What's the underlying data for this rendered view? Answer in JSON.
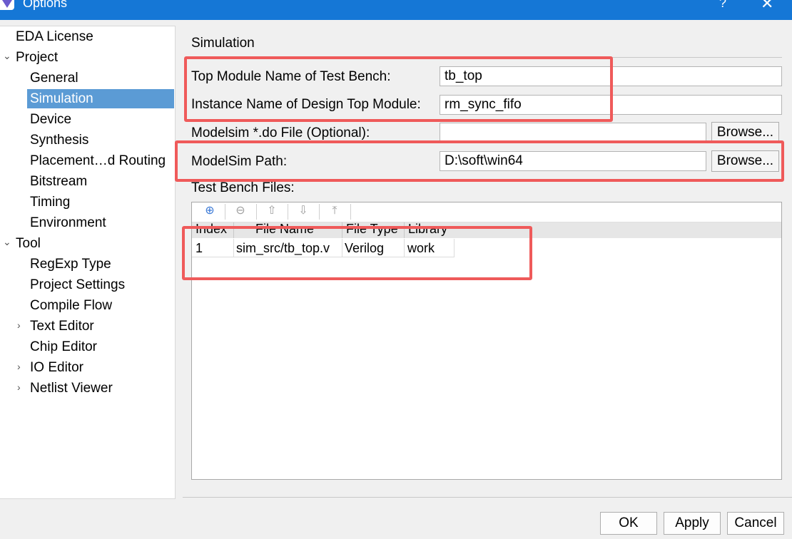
{
  "window": {
    "title": "Options",
    "help_glyph": "?",
    "close_glyph": "✕"
  },
  "tree": {
    "items": [
      {
        "label": "EDA License",
        "level": 0,
        "expander": ""
      },
      {
        "label": "Project",
        "level": 0,
        "expander": "expanded"
      },
      {
        "label": "General",
        "level": 1,
        "expander": ""
      },
      {
        "label": "Simulation",
        "level": 1,
        "expander": "",
        "selected": true
      },
      {
        "label": "Device",
        "level": 1,
        "expander": ""
      },
      {
        "label": "Synthesis",
        "level": 1,
        "expander": ""
      },
      {
        "label": "Placement…d Routing",
        "level": 1,
        "expander": ""
      },
      {
        "label": "Bitstream",
        "level": 1,
        "expander": ""
      },
      {
        "label": "Timing",
        "level": 1,
        "expander": ""
      },
      {
        "label": "Environment",
        "level": 1,
        "expander": ""
      },
      {
        "label": "Tool",
        "level": 0,
        "expander": "expanded"
      },
      {
        "label": "RegExp Type",
        "level": 1,
        "expander": ""
      },
      {
        "label": "Project Settings",
        "level": 1,
        "expander": ""
      },
      {
        "label": "Compile Flow",
        "level": 1,
        "expander": ""
      },
      {
        "label": "Text Editor",
        "level": 1,
        "expander": "collapsed"
      },
      {
        "label": "Chip Editor",
        "level": 1,
        "expander": ""
      },
      {
        "label": "IO Editor",
        "level": 1,
        "expander": "collapsed"
      },
      {
        "label": "Netlist Viewer",
        "level": 1,
        "expander": "collapsed"
      }
    ]
  },
  "simulation": {
    "section_title": "Simulation",
    "top_module_label": "Top Module Name of Test Bench:",
    "top_module_value": "tb_top",
    "instance_label": "Instance Name of Design Top Module:",
    "instance_value": "rm_sync_fifo",
    "do_file_label": "Modelsim *.do File (Optional):",
    "do_file_value": "",
    "browse_label": "Browse...",
    "modelsim_path_label": "ModelSim Path:",
    "modelsim_path_value": "D:\\soft\\win64",
    "test_bench_files_label": "Test Bench Files:"
  },
  "table": {
    "toolbar_icons": [
      "add-icon",
      "remove-icon",
      "move-up-icon",
      "move-down-icon",
      "move-top-icon"
    ],
    "toolbar_glyphs": {
      "add": "⊕",
      "remove": "⊖",
      "up": "⇧",
      "down": "⇩",
      "top": "⤒"
    },
    "columns": [
      "Index",
      "File Name",
      "File Type",
      "Library"
    ],
    "rows": [
      [
        "1",
        "sim_src/tb_top.v",
        "Verilog",
        "work"
      ]
    ]
  },
  "buttons": {
    "ok": "OK",
    "apply": "Apply",
    "cancel": "Cancel"
  },
  "colors": {
    "titlebar": "#1577d6",
    "selection": "#5b9bd5",
    "highlight_box": "#ef5a5a"
  }
}
